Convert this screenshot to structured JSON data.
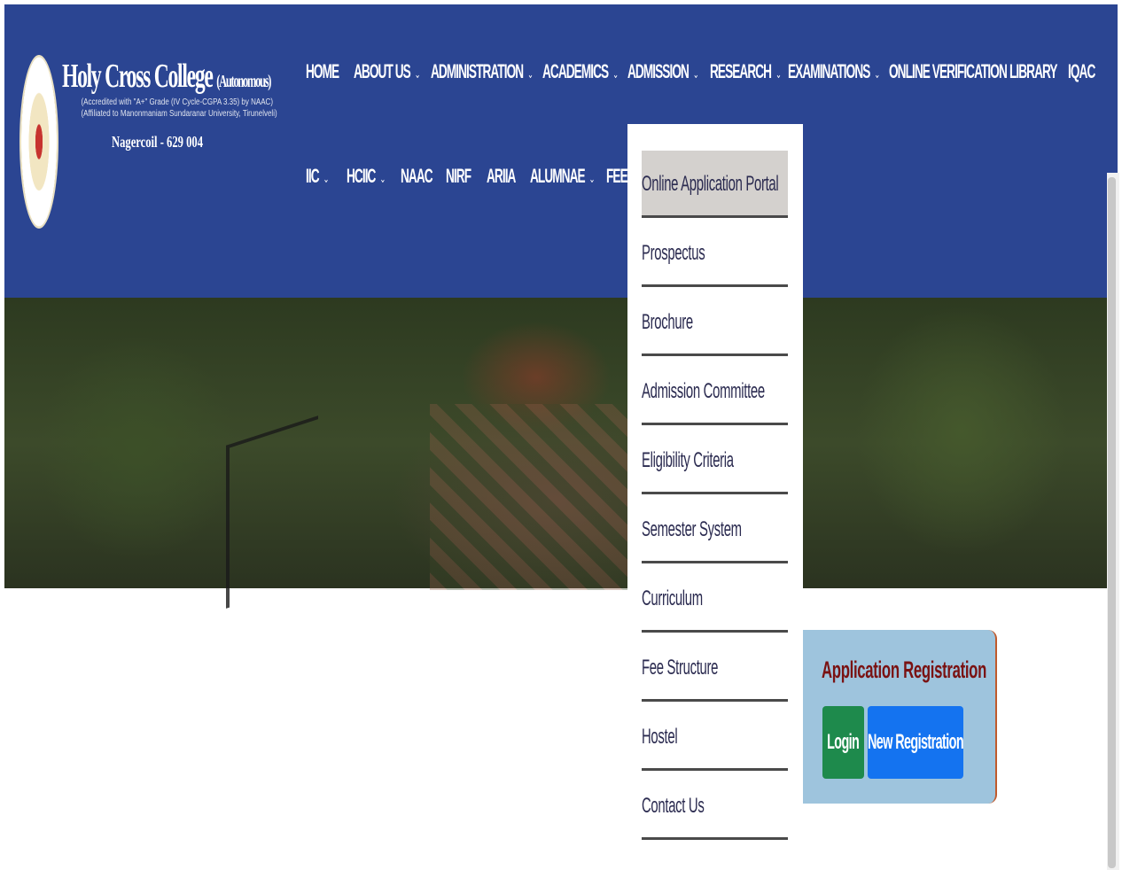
{
  "brand": {
    "title": "Holy Cross College",
    "title_suffix": "(Autonomous)",
    "line1": "(Accredited with \"A+\" Grade (IV Cycle-CGPA 3.35) by NAAC)",
    "line2": "(Affiliated to Manonmaniam Sundaranar University, Tirunelveli)",
    "city": "Nagercoil - 629 004"
  },
  "nav": {
    "row1": [
      {
        "label": "HOME",
        "dropdown": false
      },
      {
        "label": "ABOUT US",
        "dropdown": true
      },
      {
        "label": "ADMINISTRATION",
        "dropdown": true
      },
      {
        "label": "ACADEMICS",
        "dropdown": true
      },
      {
        "label": "ADMISSION",
        "dropdown": true
      },
      {
        "label": "RESEARCH",
        "dropdown": true
      },
      {
        "label": "EXAMINATIONS",
        "dropdown": true
      },
      {
        "label": "ONLINE VERIFICATION",
        "dropdown": false
      },
      {
        "label": "LIBRARY",
        "dropdown": false
      },
      {
        "label": "IQAC",
        "dropdown": false
      }
    ],
    "row2": [
      {
        "label": "IIC",
        "dropdown": true
      },
      {
        "label": "HCIIC",
        "dropdown": true
      },
      {
        "label": "NAAC",
        "dropdown": false
      },
      {
        "label": "NIRF",
        "dropdown": false
      },
      {
        "label": "ARIIA",
        "dropdown": false
      },
      {
        "label": "ALUMNAE",
        "dropdown": true
      },
      {
        "label": "FEED",
        "dropdown": false
      }
    ],
    "chevron": "⌄"
  },
  "admission_menu": {
    "items": [
      {
        "label": "Online Application Portal",
        "active": true
      },
      {
        "label": "Prospectus",
        "active": false
      },
      {
        "label": "Brochure",
        "active": false
      },
      {
        "label": "Admission Committee",
        "active": false
      },
      {
        "label": "Eligibility Criteria",
        "active": false
      },
      {
        "label": "Semester System",
        "active": false
      },
      {
        "label": "Curriculum",
        "active": false
      },
      {
        "label": "Fee Structure",
        "active": false
      },
      {
        "label": "Hostel",
        "active": false
      },
      {
        "label": "Contact Us",
        "active": false
      }
    ]
  },
  "registration": {
    "title": "Application Registration",
    "login_label": "Login",
    "new_label": "New Registration"
  },
  "colors": {
    "header": "#2b4592",
    "login": "#1e8a4c",
    "new_registration": "#1473f0",
    "card": "#9ec4dd",
    "title": "#7a1212"
  }
}
